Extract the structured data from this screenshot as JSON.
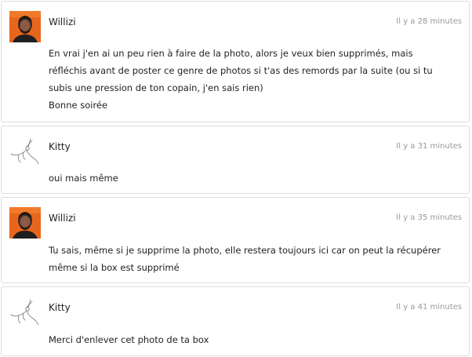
{
  "comments": [
    {
      "author": "Willizi",
      "time": "Il y a 28 minutes",
      "avatar": "male-portrait-orange-avatar",
      "lines": [
        "En vrai j'en ai un peu rien à faire de la photo, alors je veux bien supprimés, mais",
        "réfléchis avant de poster ce genre de photos si t'as des remords par la suite (ou si tu",
        "subis une pression de ton copain, j'en sais rien)",
        "Bonne soirée"
      ]
    },
    {
      "author": "Kitty",
      "time": "Il y a 31 minutes",
      "avatar": "dancer-sketch-avatar",
      "lines": [
        "oui mais même"
      ]
    },
    {
      "author": "Willizi",
      "time": "Il y a 35 minutes",
      "avatar": "male-portrait-orange-avatar",
      "lines": [
        "Tu sais, même si je supprime la photo, elle restera toujours ici car on peut la récupérer",
        "même si la box est supprimé"
      ]
    },
    {
      "author": "Kitty",
      "time": "Il y a 41 minutes",
      "avatar": "dancer-sketch-avatar",
      "lines": [
        "Merci d'enlever cet photo de ta box"
      ]
    }
  ]
}
